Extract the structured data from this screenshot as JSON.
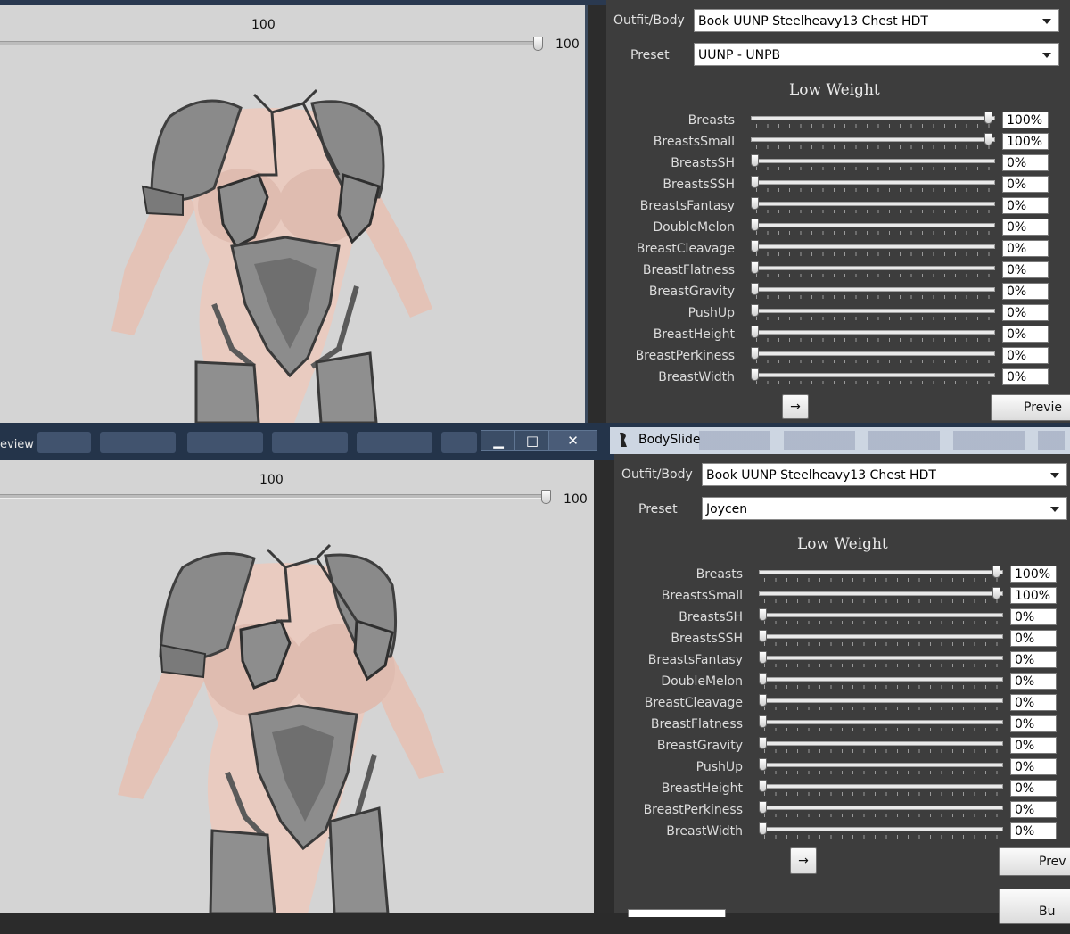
{
  "top": {
    "preview": {
      "slider_header": "100",
      "slider_value": "100",
      "slider_level": 1.0
    },
    "bodyslide": {
      "outfit_label": "Outfit/Body",
      "outfit_value": "Book UUNP Steelheavy13 Chest HDT",
      "preset_label": "Preset",
      "preset_value": "UUNP - UNPB",
      "section_title": "Low Weight",
      "sliders": [
        {
          "name": "Breasts",
          "value": "100%",
          "level": 1.0
        },
        {
          "name": "BreastsSmall",
          "value": "100%",
          "level": 1.0
        },
        {
          "name": "BreastsSH",
          "value": "0%",
          "level": 0
        },
        {
          "name": "BreastsSSH",
          "value": "0%",
          "level": 0
        },
        {
          "name": "BreastsFantasy",
          "value": "0%",
          "level": 0
        },
        {
          "name": "DoubleMelon",
          "value": "0%",
          "level": 0
        },
        {
          "name": "BreastCleavage",
          "value": "0%",
          "level": 0
        },
        {
          "name": "BreastFlatness",
          "value": "0%",
          "level": 0
        },
        {
          "name": "BreastGravity",
          "value": "0%",
          "level": 0
        },
        {
          "name": "PushUp",
          "value": "0%",
          "level": 0
        },
        {
          "name": "BreastHeight",
          "value": "0%",
          "level": 0
        },
        {
          "name": "BreastPerkiness",
          "value": "0%",
          "level": 0
        },
        {
          "name": "BreastWidth",
          "value": "0%",
          "level": 0
        }
      ],
      "arrow_button": "→",
      "preview_button": "Previe"
    }
  },
  "middle_bar": {
    "window_title": "eview",
    "minimize": "▁",
    "maximize": "□",
    "close": "✕",
    "bodyslide_title": "BodySlide"
  },
  "bottom": {
    "preview": {
      "slider_header": "100",
      "slider_value": "100",
      "slider_level": 1.0
    },
    "bodyslide": {
      "outfit_label": "Outfit/Body",
      "outfit_value": "Book UUNP Steelheavy13 Chest HDT",
      "preset_label": "Preset",
      "preset_value": "Joycen",
      "section_title": "Low Weight",
      "sliders": [
        {
          "name": "Breasts",
          "value": "100%",
          "level": 1.0
        },
        {
          "name": "BreastsSmall",
          "value": "100%",
          "level": 1.0
        },
        {
          "name": "BreastsSH",
          "value": "0%",
          "level": 0
        },
        {
          "name": "BreastsSSH",
          "value": "0%",
          "level": 0
        },
        {
          "name": "BreastsFantasy",
          "value": "0%",
          "level": 0
        },
        {
          "name": "DoubleMelon",
          "value": "0%",
          "level": 0
        },
        {
          "name": "BreastCleavage",
          "value": "0%",
          "level": 0
        },
        {
          "name": "BreastFlatness",
          "value": "0%",
          "level": 0
        },
        {
          "name": "BreastGravity",
          "value": "0%",
          "level": 0
        },
        {
          "name": "PushUp",
          "value": "0%",
          "level": 0
        },
        {
          "name": "BreastHeight",
          "value": "0%",
          "level": 0
        },
        {
          "name": "BreastPerkiness",
          "value": "0%",
          "level": 0
        },
        {
          "name": "BreastWidth",
          "value": "0%",
          "level": 0
        }
      ],
      "arrow_button": "→",
      "preview_button": "Prev",
      "build_button": "Bu"
    }
  },
  "colors": {
    "panel_bg": "#3d3d3d",
    "preview_bg": "#d4d4d4",
    "skin": "#e6c6ba",
    "armor": "#8f8f8f"
  }
}
